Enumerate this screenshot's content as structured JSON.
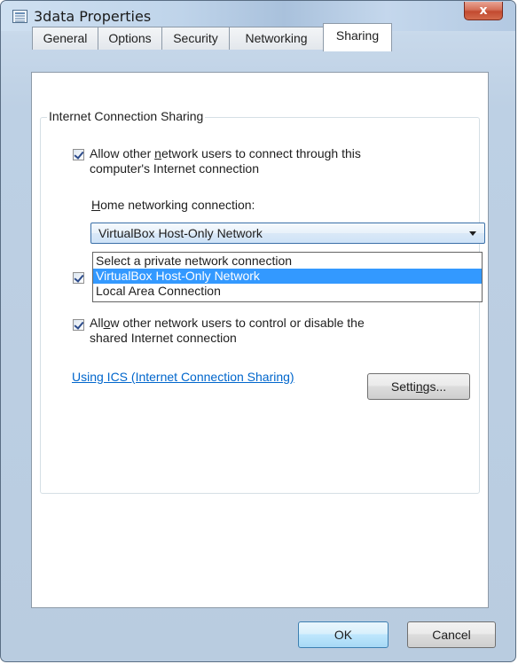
{
  "window": {
    "title": "3data Properties",
    "close_glyph": "x"
  },
  "tabs": [
    {
      "label": "General",
      "active": false
    },
    {
      "label": "Options",
      "active": false
    },
    {
      "label": "Security",
      "active": false
    },
    {
      "label": "Networking",
      "active": false
    },
    {
      "label": "Sharing",
      "active": true
    }
  ],
  "group": {
    "label": "Internet Connection Sharing"
  },
  "allow_connect": {
    "checked": true,
    "line1_before": "Allow other ",
    "line1_hotkey": "n",
    "line1_after": "etwork users to connect through this",
    "line2": "computer's Internet connection"
  },
  "home_network": {
    "label_hotkey": "H",
    "label_rest": "ome networking connection:",
    "selected_value": "VirtualBox Host-Only Network",
    "options": [
      {
        "label": "Select a private network connection",
        "selected": false
      },
      {
        "label": "VirtualBox Host-Only Network",
        "selected": true
      },
      {
        "label": "Local Area Connection",
        "selected": false
      }
    ]
  },
  "hidden_checkbox": {
    "checked": true
  },
  "allow_control": {
    "checked": true,
    "line1_before": "All",
    "line1_hotkey": "o",
    "line1_after": "w other network users to control or disable the",
    "line2": "shared Internet connection"
  },
  "ics_link": {
    "label": "Using ICS (Internet Connection Sharing)"
  },
  "settings_button": {
    "before": "Setti",
    "hotkey": "n",
    "after": "gs..."
  },
  "footer": {
    "ok_label": "OK",
    "cancel_label": "Cancel"
  },
  "colors": {
    "link": "#0066cc",
    "selection": "#3399ff",
    "close_button": "#c24a30"
  },
  "icons": {
    "title_icon": "properties-sheet-icon",
    "close_icon": "close-x-icon",
    "dropdown_arrow": "chevron-down-icon",
    "checkbox": "checkmark-icon"
  }
}
